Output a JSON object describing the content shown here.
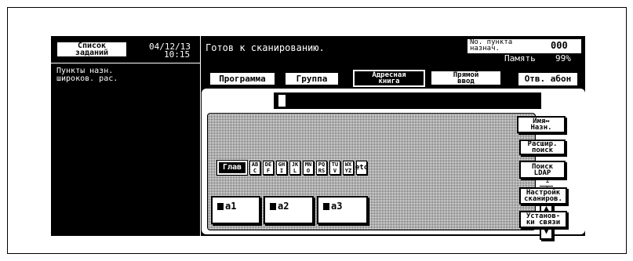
{
  "jobs": {
    "button_line1": "Список",
    "button_line2": "заданий",
    "date": "04/12/13",
    "time": "10:15"
  },
  "left_panel": {
    "line1": "Пункты назн.",
    "line2": "широков. рас."
  },
  "status": {
    "message": "Готов к сканированию.",
    "dest_label_line1": "No. пункта",
    "dest_label_line2": "назнач.",
    "dest_count": "000",
    "memory_label": "Память",
    "memory_value": "99%"
  },
  "tabs": [
    {
      "label": "Программа"
    },
    {
      "label": "Группа"
    },
    {
      "label_line1": "Адресная",
      "label_line2": "книга"
    },
    {
      "label_line1": "Прямой",
      "label_line2": "ввод"
    }
  ],
  "reply_button": "Отв. абон",
  "index_keys": [
    "Глав",
    "AB\nC",
    "DE\nF",
    "GH\nI",
    "JK\nL",
    "MN\nO",
    "PQ\nRS",
    "TU\nV",
    "WX\nYZ",
    "etc"
  ],
  "entries": [
    "a1",
    "a2",
    "a3"
  ],
  "page_counter": {
    "current": "1",
    "total": "1"
  },
  "side_buttons": [
    {
      "line1": "Имя↔",
      "line2": "Назн."
    },
    {
      "line1": "Расшир.",
      "line2": "поиск"
    },
    {
      "line1": "Поиск",
      "line2": "LDAP"
    },
    {
      "line1": "Настройк",
      "line2": "сканиров."
    },
    {
      "line1": "Установ-",
      "line2": "ки связи"
    }
  ],
  "icons": {
    "scroll_up": "up-arrow-icon",
    "scroll_down": "down-arrow-icon"
  },
  "colors": {
    "screen": "#000000",
    "panel": "#ffffff"
  }
}
